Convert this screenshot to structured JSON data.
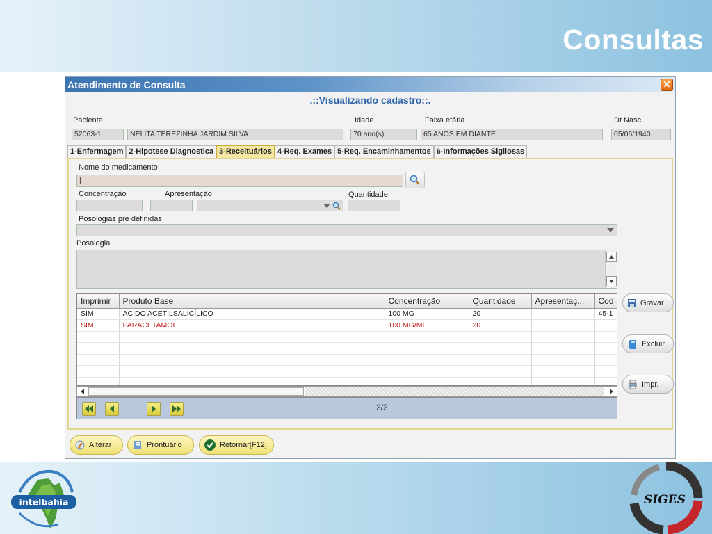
{
  "slide": {
    "title": "Consultas"
  },
  "window": {
    "title": "Atendimento de Consulta",
    "subtitle": ".::Visualizando cadastro::."
  },
  "patient": {
    "label_paciente": "Paciente",
    "code": "52063-1",
    "name": "NELITA TEREZINHA JARDIM SILVA",
    "label_idade": "Idade",
    "idade": "70 ano(s)",
    "label_faixa": "Faixa etária",
    "faixa": "65 ANOS EM DIANTE",
    "label_nasc": "Dt Nasc.",
    "nasc": "05/06/1940"
  },
  "tabs": [
    {
      "label": "1-Enfermagem"
    },
    {
      "label": "2-Hipotese Diagnostica"
    },
    {
      "label": "3-Receituários",
      "active": true
    },
    {
      "label": "4-Req. Exames"
    },
    {
      "label": "5-Req. Encaminhamentos"
    },
    {
      "label": "6-Informações Sigilosas"
    }
  ],
  "form": {
    "label_medicamento": "Nome do medicamento",
    "medicamento_value": "|",
    "label_concentracao": "Concentração",
    "label_apresentacao": "Apresentação",
    "label_quantidade": "Quantidade",
    "label_posologias": "Posologias pré definidas",
    "label_posologia": "Posologia"
  },
  "grid": {
    "columns": [
      "Imprimir",
      "Produto Base",
      "Concentração",
      "Quantidade",
      "Apresentaç...",
      "Cod"
    ],
    "rows": [
      [
        "SIM",
        "ACIDO ACETILSALICÍLICO",
        "100 MG",
        "20",
        "",
        "45-1"
      ],
      [
        "SIM",
        "PARACETAMOL",
        "100 MG/ML",
        "20",
        "",
        ""
      ]
    ],
    "page_indicator": "2/2"
  },
  "side_buttons": {
    "gravar": "Gravar",
    "excluir": "Excluir",
    "imprimir": "Impr."
  },
  "footer_buttons": {
    "alterar": "Alterar",
    "prontuario": "Prontuário",
    "retornar": "Retornar[F12]"
  },
  "logos": {
    "intelbahia": "intelbahia",
    "siges": "SIGES"
  },
  "colors": {
    "title_blue": "#3c73b1",
    "active_tab": "#f5e6a3",
    "red_row": "#c01818"
  }
}
